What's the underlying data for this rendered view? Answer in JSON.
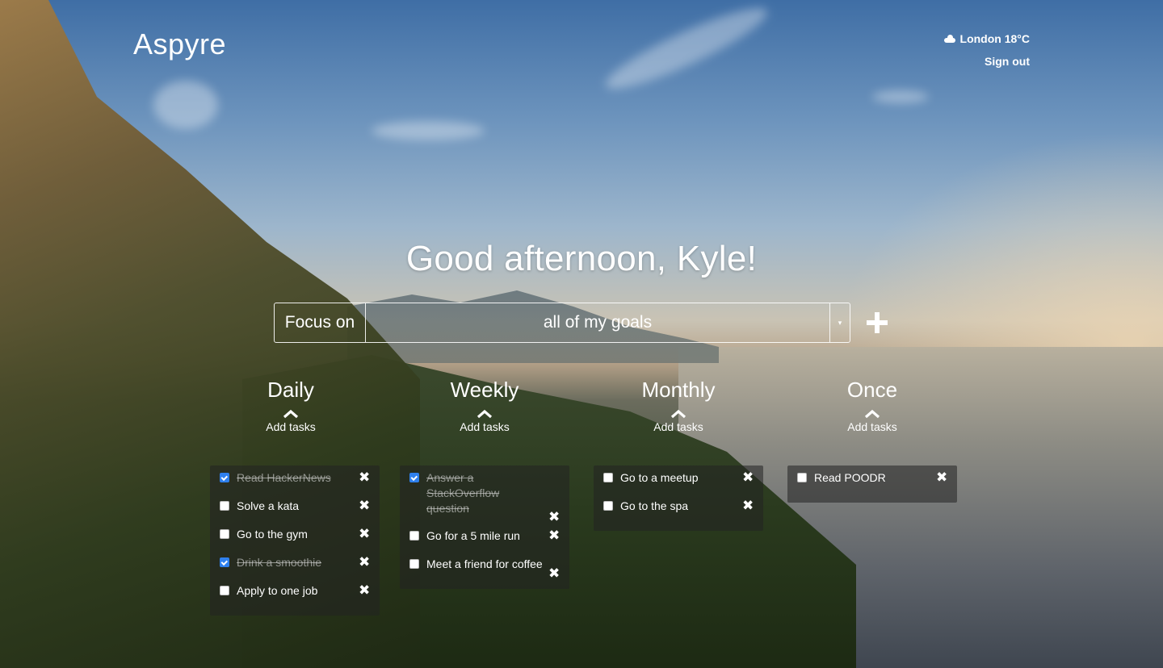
{
  "header": {
    "logo": "Aspyre",
    "weather": "London 18°C",
    "weather_icon": "cloud-icon",
    "sign_out": "Sign out"
  },
  "greeting": "Good afternoon, Kyle!",
  "focus": {
    "label": "Focus on",
    "selected": "all of my goals",
    "caret": "▾",
    "add_icon": "plus-icon"
  },
  "columns": [
    {
      "title": "Daily",
      "add_label": "Add tasks",
      "tasks": [
        {
          "text": "Read HackerNews",
          "done": true
        },
        {
          "text": "Solve a kata",
          "done": false
        },
        {
          "text": "Go to the gym",
          "done": false
        },
        {
          "text": "Drink a smoothie",
          "done": true
        },
        {
          "text": "Apply to one job",
          "done": false
        }
      ]
    },
    {
      "title": "Weekly",
      "add_label": "Add tasks",
      "tasks": [
        {
          "text": "Answer a StackOverflow question",
          "done": true
        },
        {
          "text": "Go for a 5 mile run",
          "done": false
        },
        {
          "text": "Meet a friend for coffee",
          "done": false
        }
      ]
    },
    {
      "title": "Monthly",
      "add_label": "Add tasks",
      "tasks": [
        {
          "text": "Go to a meetup",
          "done": false
        },
        {
          "text": "Go to the spa",
          "done": false
        }
      ]
    },
    {
      "title": "Once",
      "add_label": "Add tasks",
      "tasks": [
        {
          "text": "Read POODR",
          "done": false
        }
      ]
    }
  ],
  "delete_glyph": "✖",
  "colors": {
    "checkbox_checked": "#2f80ed",
    "panel_bg": "rgba(35,35,35,0.55)",
    "text": "#ffffff"
  }
}
